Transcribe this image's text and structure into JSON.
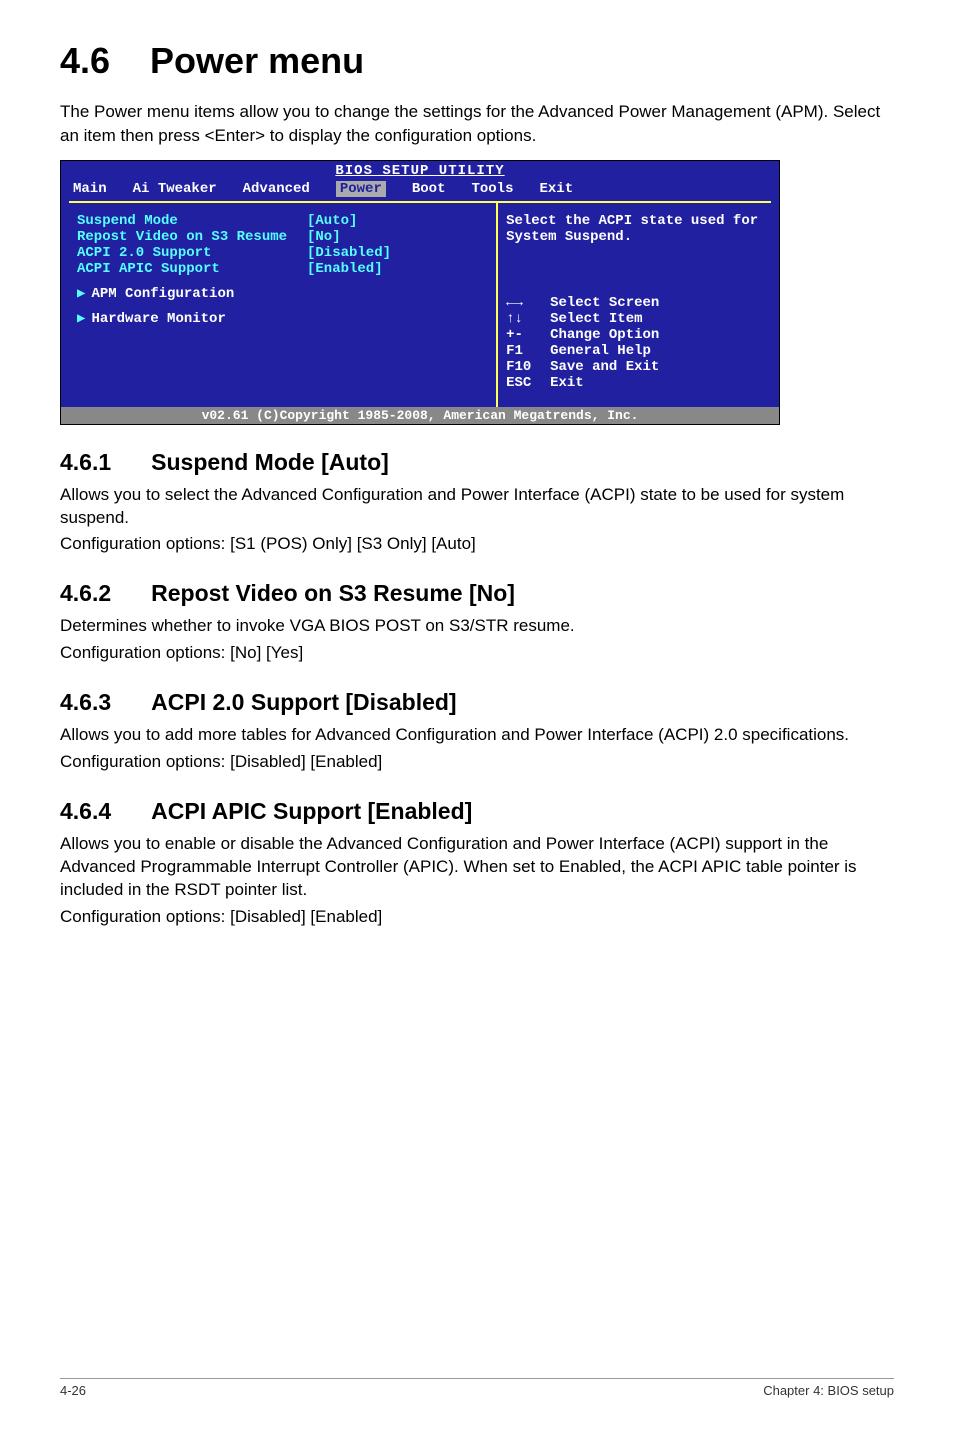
{
  "header": {
    "num": "4.6",
    "title": "Power menu"
  },
  "intro": "The Power menu items allow you to change the settings for the Advanced Power Management (APM). Select an item then press <Enter> to display the configuration options.",
  "bios": {
    "header": "BIOS SETUP UTILITY",
    "tabs": [
      "Main",
      "Ai Tweaker",
      "Advanced",
      "Power",
      "Boot",
      "Tools",
      "Exit"
    ],
    "active_tab": "Power",
    "rows": [
      {
        "label": "Suspend Mode",
        "val": "[Auto]"
      },
      {
        "label": "Repost Video on S3 Resume",
        "val": "[No]"
      },
      {
        "label": "ACPI 2.0 Support",
        "val": "[Disabled]"
      },
      {
        "label": "ACPI APIC Support",
        "val": "[Enabled]"
      }
    ],
    "subs": [
      "APM Configuration",
      "Hardware Monitor"
    ],
    "help_top": "Select the ACPI state used for System Suspend.",
    "keys": [
      {
        "k": "←→",
        "t": "Select Screen"
      },
      {
        "k": "↑↓",
        "t": "Select Item"
      },
      {
        "k": "+-",
        "t": "Change Option"
      },
      {
        "k": "F1",
        "t": "General Help"
      },
      {
        "k": "F10",
        "t": "Save and Exit"
      },
      {
        "k": "ESC",
        "t": "Exit"
      }
    ],
    "footer": "v02.61 (C)Copyright 1985-2008, American Megatrends, Inc."
  },
  "sections": [
    {
      "num": "4.6.1",
      "title": "Suspend Mode [Auto]",
      "paras": [
        "Allows you to select the Advanced Configuration and Power Interface (ACPI) state to be used for system suspend.",
        "Configuration options: [S1 (POS) Only] [S3 Only] [Auto]"
      ]
    },
    {
      "num": "4.6.2",
      "title": "Repost Video on S3 Resume [No]",
      "paras": [
        "Determines whether to invoke VGA BIOS POST on S3/STR resume.",
        "Configuration options: [No] [Yes]"
      ]
    },
    {
      "num": "4.6.3",
      "title": "ACPI 2.0 Support [Disabled]",
      "paras": [
        "Allows you to add more tables for Advanced Configuration and Power Interface (ACPI) 2.0 specifications.",
        "Configuration options: [Disabled] [Enabled]"
      ]
    },
    {
      "num": "4.6.4",
      "title": "ACPI APIC Support [Enabled]",
      "paras": [
        "Allows you to enable or disable the Advanced Configuration and Power Interface (ACPI) support in the Advanced Programmable Interrupt Controller (APIC). When set to Enabled, the ACPI APIC table pointer is included in the RSDT pointer list.",
        "Configuration options: [Disabled] [Enabled]"
      ]
    }
  ],
  "footer": {
    "left": "4-26",
    "right": "Chapter 4: BIOS setup"
  }
}
